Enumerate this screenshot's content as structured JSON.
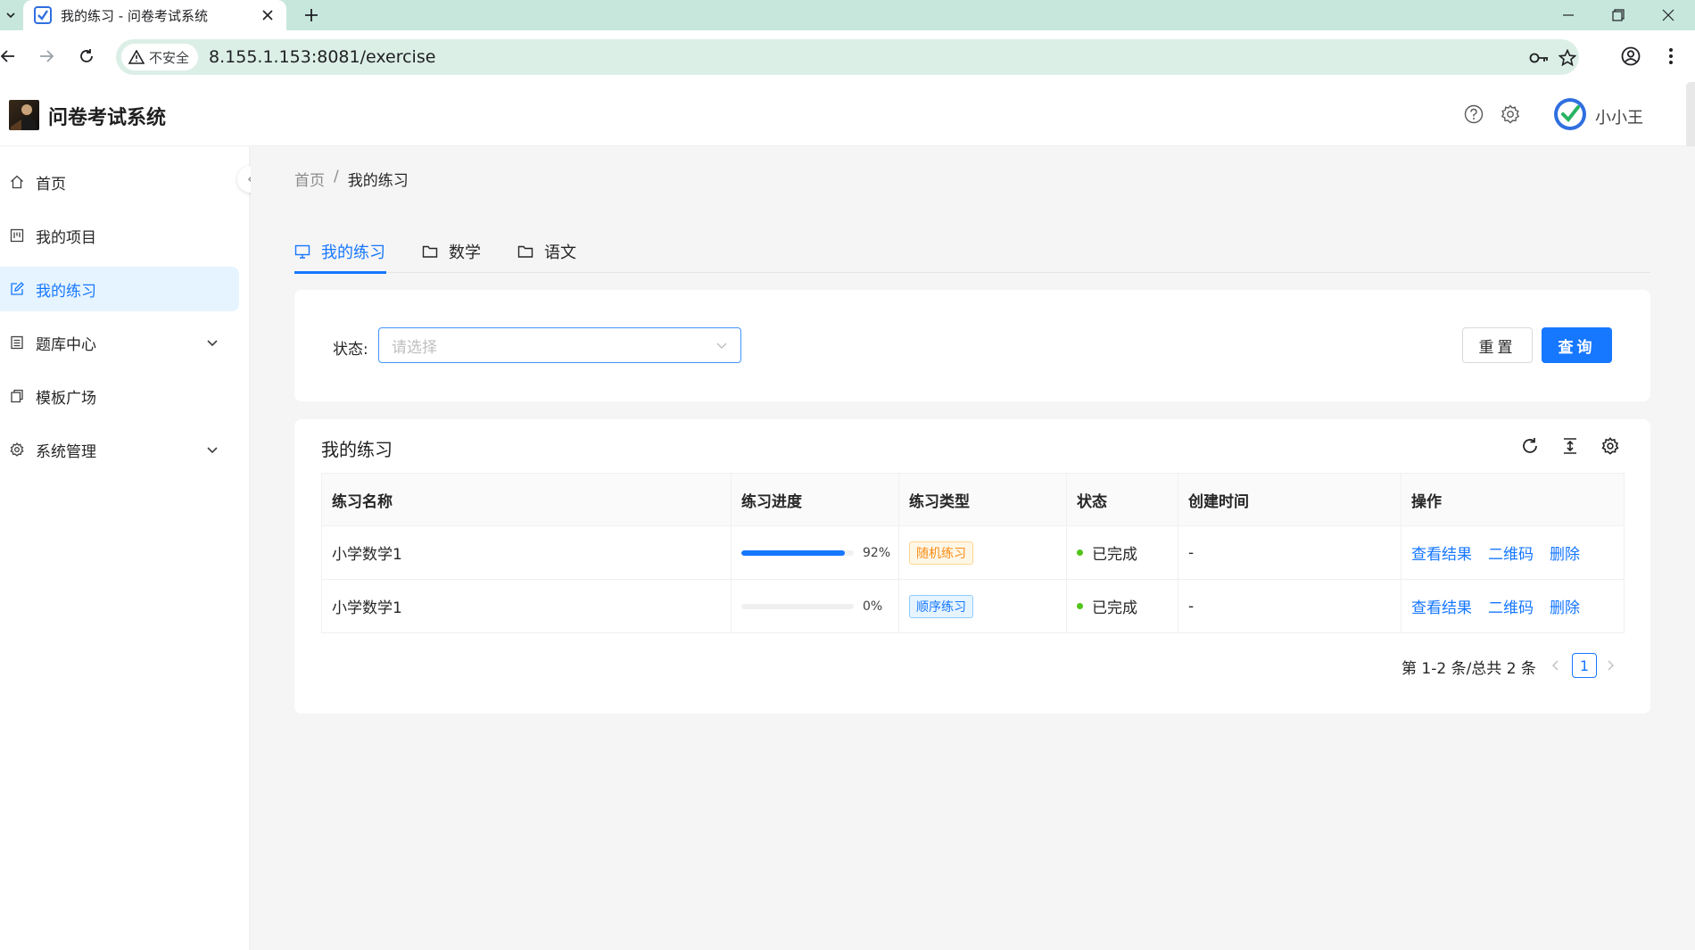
{
  "browser": {
    "tab_title": "我的练习 - 问卷考试系统",
    "security_label": "不安全",
    "url": "8.155.1.153:8081/exercise"
  },
  "app": {
    "title": "问卷考试系统",
    "username": "小小王"
  },
  "sidebar": {
    "items": [
      {
        "label": "首页",
        "icon": "home-icon"
      },
      {
        "label": "我的项目",
        "icon": "project-icon"
      },
      {
        "label": "我的练习",
        "icon": "edit-icon",
        "active": true
      },
      {
        "label": "题库中心",
        "icon": "list-icon",
        "expandable": true
      },
      {
        "label": "模板广场",
        "icon": "copy-icon"
      },
      {
        "label": "系统管理",
        "icon": "gear-icon",
        "expandable": true
      }
    ]
  },
  "breadcrumb": {
    "home": "首页",
    "separator": "/",
    "current": "我的练习"
  },
  "tabs": [
    {
      "label": "我的练习",
      "icon": "desktop-icon",
      "active": true
    },
    {
      "label": "数学",
      "icon": "folder-icon"
    },
    {
      "label": "语文",
      "icon": "folder-icon"
    }
  ],
  "filter": {
    "label": "状态:",
    "placeholder": "请选择",
    "reset_label": "重置",
    "query_label": "查询"
  },
  "table": {
    "title": "我的练习",
    "columns": [
      "练习名称",
      "练习进度",
      "练习类型",
      "状态",
      "创建时间",
      "操作"
    ],
    "rows": [
      {
        "name": "小学数学1",
        "progress": 92,
        "progress_text": "92%",
        "type": "随机练习",
        "type_color": "orange",
        "status": "已完成",
        "created": "-",
        "actions": [
          "查看结果",
          "二维码",
          "删除"
        ]
      },
      {
        "name": "小学数学1",
        "progress": 0,
        "progress_text": "0%",
        "type": "顺序练习",
        "type_color": "blue",
        "status": "已完成",
        "created": "-",
        "actions": [
          "查看结果",
          "二维码",
          "删除"
        ]
      }
    ]
  },
  "pagination": {
    "total_text": "第 1-2 条/总共 2 条",
    "current_page": "1"
  },
  "colors": {
    "primary": "#1677ff",
    "success": "#52c41a",
    "tab_bar": "#c7e7dd"
  }
}
